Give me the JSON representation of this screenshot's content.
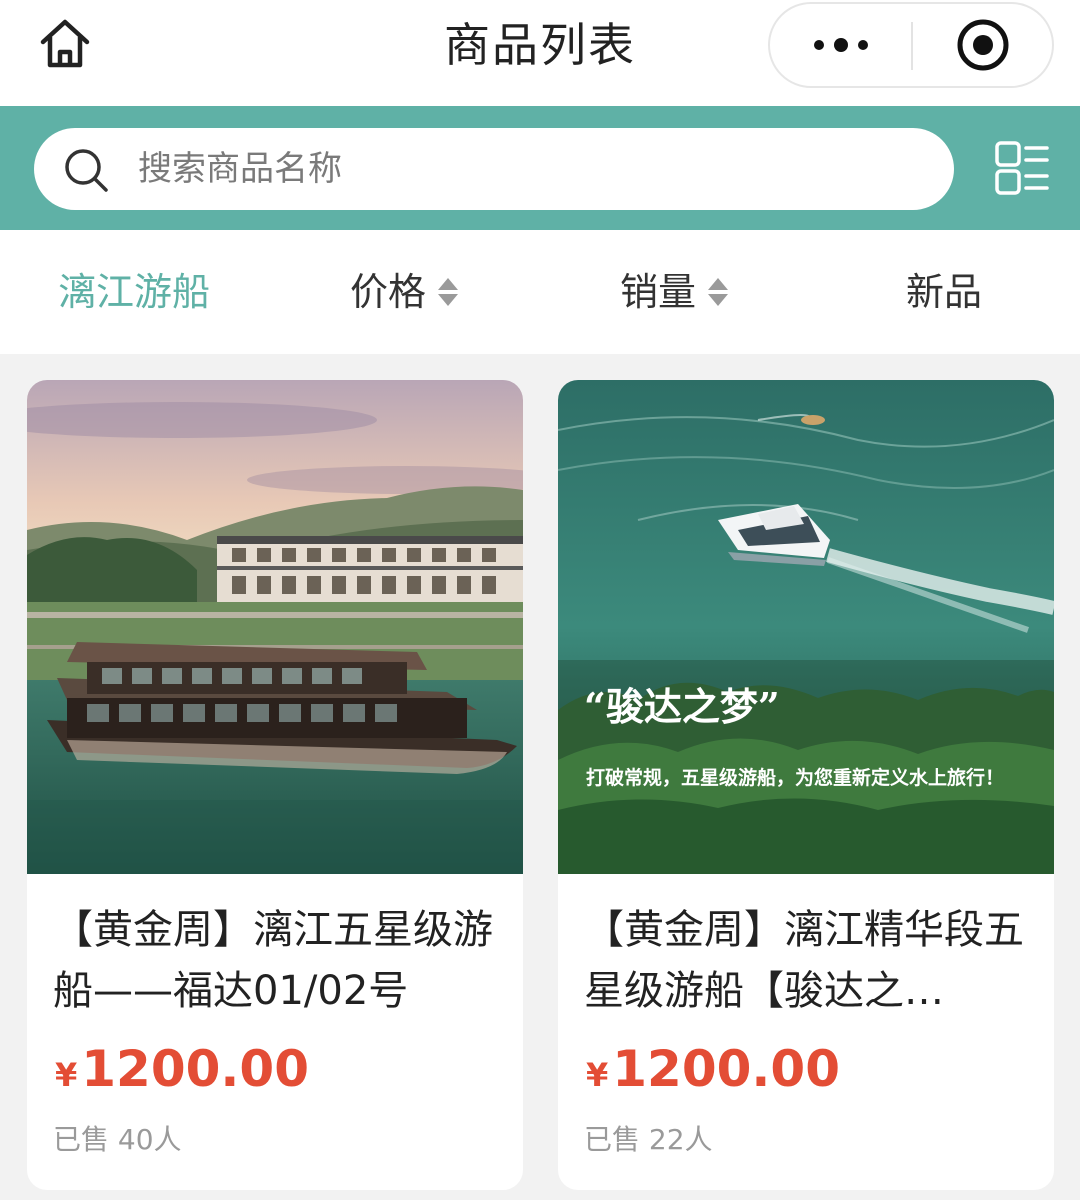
{
  "navbar": {
    "title": "商品列表",
    "home_icon": "home-icon",
    "more_icon": "more-dots-icon",
    "close_icon": "target-icon"
  },
  "search": {
    "placeholder": "搜索商品名称",
    "icon": "search-icon",
    "layout_icon": "list-grid-icon"
  },
  "sort": {
    "items": [
      {
        "label": "漓江游船",
        "active": true
      },
      {
        "label": "价格",
        "sortable": true
      },
      {
        "label": "销量",
        "sortable": true
      },
      {
        "label": "新品"
      }
    ]
  },
  "products": [
    {
      "title": "【黄金周】漓江五星级游船——福达01/02号",
      "currency": "¥",
      "price": "1200.00",
      "sold": "已售 40人"
    },
    {
      "title": "【黄金周】漓江精华段五星级游船【骏达之…",
      "currency": "¥",
      "price": "1200.00",
      "sold": "已售 22人",
      "image_caption": "“骏达之梦”",
      "image_subcaption": "打破常规，五星级游船，为您重新定义水上旅行！"
    }
  ],
  "colors": {
    "accent": "#5fb1a6",
    "price": "#e34d35",
    "background": "#f2f2f2"
  }
}
